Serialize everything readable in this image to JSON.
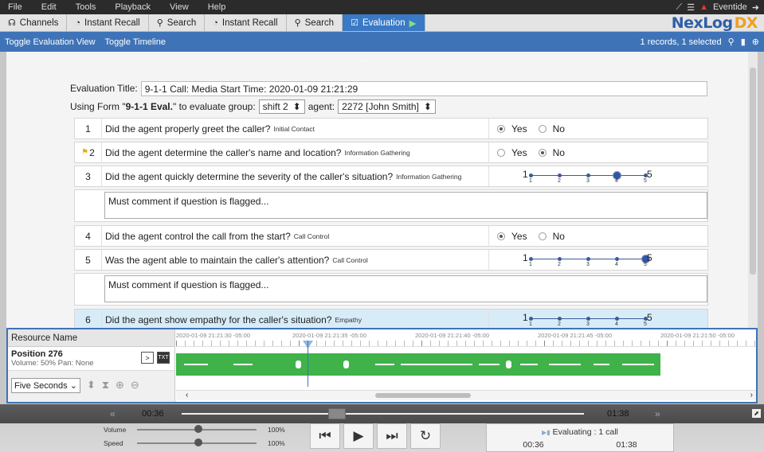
{
  "menu": {
    "items": [
      "File",
      "Edit",
      "Tools",
      "Playback",
      "View",
      "Help"
    ],
    "user": "Eventide"
  },
  "tabs": [
    {
      "icon": "headphones-icon",
      "label": "Channels"
    },
    {
      "icon": "clock-icon",
      "label": "Instant Recall"
    },
    {
      "icon": "search-icon",
      "label": "Search"
    },
    {
      "icon": "clock-icon",
      "label": "Instant Recall"
    },
    {
      "icon": "search-icon",
      "label": "Search"
    },
    {
      "icon": "checkbox-icon",
      "label": "Evaluation"
    }
  ],
  "brand": {
    "name": "NexLog",
    "suffix": "DX"
  },
  "toolbar": {
    "toggle_eval": "Toggle Evaluation View",
    "toggle_timeline": "Toggle Timeline",
    "records": "1 records, 1 selected"
  },
  "evaluation": {
    "title_label": "Evaluation Title:",
    "title_value": "9-1-1 Call:  Media Start Time: 2020-01-09 21:21:29",
    "using_prefix": "Using Form \"",
    "form_name": "9-1-1 Eval.",
    "using_suffix": "\" to evaluate group:",
    "group": "shift 2",
    "agent_label": "agent:",
    "agent": "2272 [John Smith]",
    "comment_placeholder": "Must comment if question is flagged...",
    "yes": "Yes",
    "no": "No",
    "scale_lo": "1",
    "scale_hi": "5",
    "questions": [
      {
        "num": "1",
        "text": "Did the agent properly greet the caller?",
        "cat": "Initial Contact",
        "answer": "yes"
      },
      {
        "num": "2",
        "text": "Did the agent determine the caller's name and location?",
        "cat": "Information Gathering",
        "answer": "no",
        "flagged": true
      },
      {
        "num": "3",
        "text": "Did the agent quickly determine the severity of the caller's situation?",
        "cat": "Information Gathering",
        "scale": 4
      },
      {
        "num": "4",
        "text": "Did the agent control the call from the start?",
        "cat": "Call Control",
        "answer": "yes"
      },
      {
        "num": "5",
        "text": "Was the agent able to maintain the caller's attention?",
        "cat": "Call Control",
        "scale": 5
      },
      {
        "num": "6",
        "text": "Did the agent show empathy for the caller's situation?",
        "cat": "Empathy",
        "scale": 0
      }
    ]
  },
  "timeline": {
    "resource_label": "Resource Name",
    "position": "Position 276",
    "volume_pan": "Volume:  50%   Pan: None",
    "interval": "Five Seconds",
    "timestamps": [
      "2020-01-09 21:21:30 -05:00",
      "2020-01-09 21:21:35 -05:00",
      "2020-01-09 21:21:40 -05:00",
      "2020-01-09 21:21:45 -05:00",
      "2020-01-09 21:21:50 -05:00"
    ]
  },
  "player": {
    "current": "00:36",
    "end": "01:38",
    "volume_label": "Volume",
    "volume_value": "100%",
    "speed_label": "Speed",
    "speed_value": "100%",
    "status": "Evaluating : 1 call",
    "status_start": "00:36",
    "status_end": "01:38"
  },
  "colors": {
    "accent": "#3f73b8",
    "waveform": "#3fb24a",
    "brand": "#2f5fa7",
    "brand_dx": "#f0a020",
    "warning": "#e53935"
  }
}
